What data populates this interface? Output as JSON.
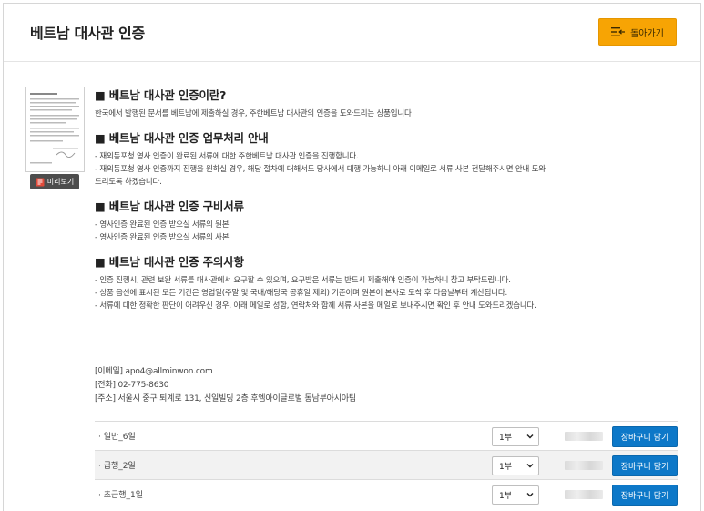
{
  "header": {
    "title": "베트남 대사관 인증",
    "back_label": "돌아가기"
  },
  "preview": {
    "label": "미리보기"
  },
  "sections": [
    {
      "title": "■ 베트남 대사관 인증이란?",
      "lines": [
        "한국에서 발행된 문서를 베트남에 제출하실 경우, 주한베트남 대사관의 인증을 도와드리는 상품입니다"
      ]
    },
    {
      "title": "■ 베트남 대사관 인증 업무처리 안내",
      "lines": [
        "- 재외동포청 영사 인증이 완료된 서류에 대한 주한베트남 대사관 인증을 진행합니다.",
        "- 재외동포청 영사 인증까지 진행을 원하실 경우, 해당 절차에 대해서도 당사에서 대행 가능하니 아래 이메일로 서류 사본 전달해주시면 안내 도와",
        "드리도록 하겠습니다."
      ]
    },
    {
      "title": "■ 베트남 대사관 인증 구비서류",
      "lines": [
        "- 영사인증 완료된 인증 받으실 서류의 원본",
        "- 영사인증 완료된 인증 받으실 서류의 사본"
      ]
    },
    {
      "title": "■ 베트남 대사관 인증 주의사항",
      "lines": [
        "- 인증 진행시, 관련 보완 서류를 대사관에서 요구할 수 있으며, 요구받은 서류는 반드시 제출해야 인증이 가능하니 참고 부탁드립니다.",
        "- 상품 옵션에 표시된 모든 기간은 영업일(주말 및 국내/해당국 공휴일 제외) 기준이며 원본이 본사로 도착 후 다음날부터 계산됩니다.",
        "- 서류에 대한 정확한 판단이 어려우신 경우, 아래 메일로 성함, 연락처와 함께 서류 사본을 메일로 보내주시면 확인 후 안내 도와드리겠습니다."
      ]
    }
  ],
  "contact": {
    "email": "[이메일] apo4@allminwon.com",
    "phone": "[전화] 02-775-8630",
    "address": "[주소] 서울시 중구 퇴계로 131, 신일빌딩 2층 후엠아이글로벌 동남부아시아팀"
  },
  "products": [
    {
      "name": "· 일반_6일",
      "qty": "1부",
      "cart_label": "장바구니 담기"
    },
    {
      "name": "· 급행_2일",
      "qty": "1부",
      "cart_label": "장바구니 담기"
    },
    {
      "name": "· 초급행_1일",
      "qty": "1부",
      "cart_label": "장바구니 담기"
    }
  ],
  "colors": {
    "accent": "#f7a404",
    "cart_button": "#0d78c8"
  }
}
